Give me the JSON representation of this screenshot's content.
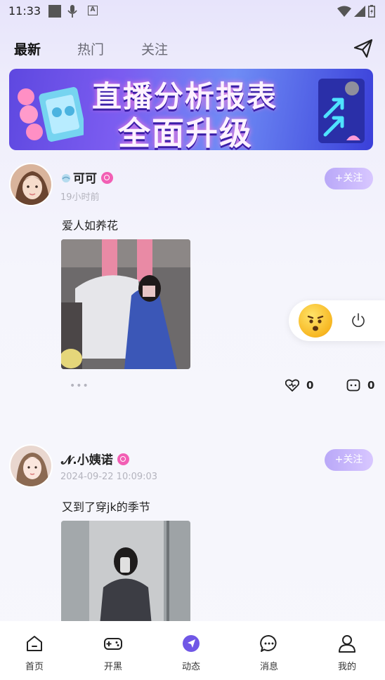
{
  "status_bar": {
    "time": "11:33"
  },
  "tabs": [
    {
      "label": "最新",
      "active": true
    },
    {
      "label": "热门",
      "active": false
    },
    {
      "label": "关注",
      "active": false
    }
  ],
  "banner": {
    "line1": "直播分析报表",
    "line2": "全面升级",
    "accent_colors": [
      "#5e48e0",
      "#ff7ad9"
    ]
  },
  "posts": [
    {
      "username": "可可",
      "time": "19小时前",
      "text": "爱人如养花",
      "follow_label": "+关注",
      "likes": "0",
      "comments": "0"
    },
    {
      "username": "𝓝.小姨诺",
      "time": "2024-09-22 10:09:03",
      "text": "又到了穿jk的季节",
      "follow_label": "+关注"
    }
  ],
  "more_label": "•••",
  "bottom_nav": [
    {
      "label": "首页",
      "icon": "home-icon"
    },
    {
      "label": "开黑",
      "icon": "gamepad-icon"
    },
    {
      "label": "动态",
      "icon": "compass-icon",
      "active": true
    },
    {
      "label": "消息",
      "icon": "chat-icon"
    },
    {
      "label": "我的",
      "icon": "user-icon"
    }
  ],
  "colors": {
    "accent": "#7b5cf0",
    "follow_button": "#c7b6fb",
    "badge": "#f25fb4"
  }
}
